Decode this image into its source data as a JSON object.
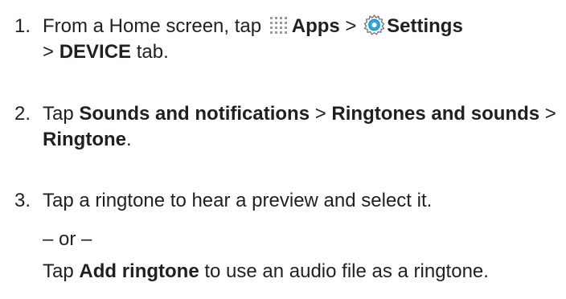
{
  "steps": [
    {
      "number": "1.",
      "text_a": "From a Home screen, tap ",
      "icon_apps": "apps-grid-icon",
      "apps": "Apps",
      "sep1": " > ",
      "icon_settings": "settings-gear-icon",
      "settings": "Settings",
      "sep2": " > ",
      "device": "DEVICE",
      "text_b": " tab."
    },
    {
      "number": "2.",
      "text_a": "Tap ",
      "sounds": "Sounds and notifications",
      "sep1": " > ",
      "ringtones": "Ringtones and sounds",
      "sep2": " > ",
      "ringtone": "Ringtone",
      "text_b": "."
    },
    {
      "number": "3.",
      "text": "Tap a ringtone to hear a preview and select it."
    }
  ],
  "or_text": "– or –",
  "alt_step": {
    "text_a": "Tap ",
    "add": "Add ringtone",
    "text_b": " to use an audio file as a ringtone."
  },
  "colors": {
    "text": "#231f20",
    "apps_icon": "#9a9a9a",
    "settings_icon_blue": "#2fa7d9",
    "settings_icon_outline": "#6b6b6b"
  }
}
